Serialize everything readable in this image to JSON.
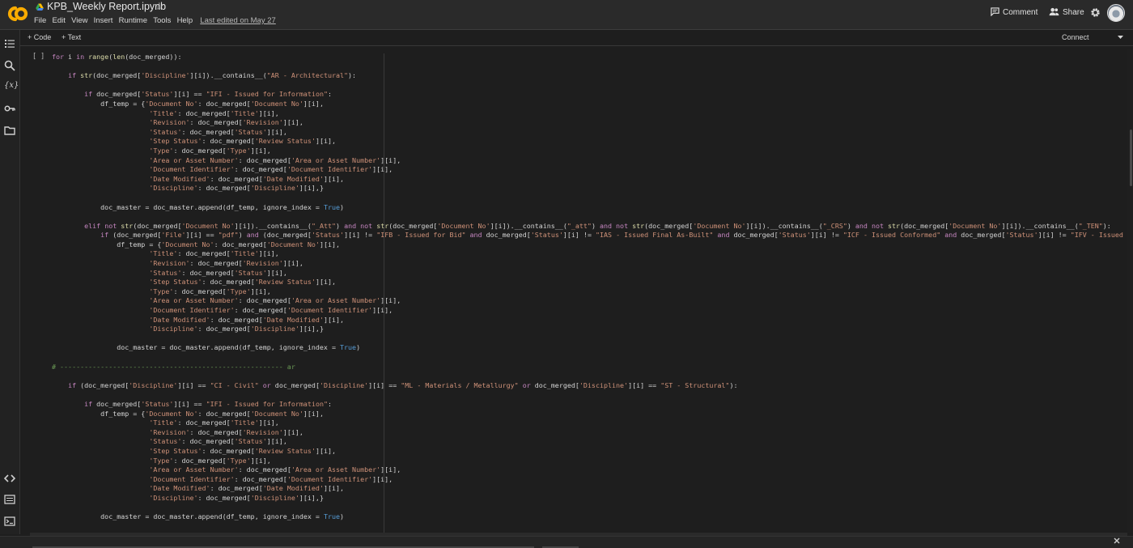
{
  "header": {
    "title": "KPB_Weekly Report.ipynb",
    "menu": [
      "File",
      "Edit",
      "View",
      "Insert",
      "Runtime",
      "Tools",
      "Help"
    ],
    "last_edited": "Last edited on May 27",
    "comment_label": "Comment",
    "share_label": "Share"
  },
  "colors": {
    "logo_orange": "#f9ab00",
    "background": "#1e1e1e",
    "header": "#2a2a2a",
    "keyword": "#c586c0",
    "string": "#ce9178",
    "comment": "#6a9955",
    "constant": "#569cd6"
  },
  "icons": {
    "logo": "colab-logo",
    "title_prefix": "drive-icon",
    "favorite": "star-icon",
    "sidebar": [
      "table-of-contents-icon",
      "search-icon",
      "variables-icon",
      "secrets-key-icon",
      "folder-icon",
      "code-snippets-icon",
      "command-palette-icon",
      "terminal-icon"
    ]
  },
  "toolbar": {
    "add_code": "+ Code",
    "add_text": "+ Text",
    "connect": "Connect"
  },
  "cell": {
    "run_indicator": "[ ]",
    "lines": [
      "for i in range(len(doc_merged)):",
      "",
      "    if str(doc_merged['Discipline'][i]).__contains__(\"AR - Architectural\"):",
      "",
      "        if doc_merged['Status'][i] == \"IFI - Issued for Information\":",
      "            df_temp = {'Document No': doc_merged['Document No'][i],",
      "                        'Title': doc_merged['Title'][i],",
      "                        'Revision': doc_merged['Revision'][i],",
      "                        'Status': doc_merged['Status'][i],",
      "                        'Step Status': doc_merged['Review Status'][i],",
      "                        'Type': doc_merged['Type'][i],",
      "                        'Area or Asset Number': doc_merged['Area or Asset Number'][i],",
      "                        'Document Identifier': doc_merged['Document Identifier'][i],",
      "                        'Date Modified': doc_merged['Date Modified'][i],",
      "                        'Discipline': doc_merged['Discipline'][i],}",
      "",
      "            doc_master = doc_master.append(df_temp, ignore_index = True)",
      "",
      "        elif not str(doc_merged['Document No'][i]).__contains__(\"_Att\") and not str(doc_merged['Document No'][i]).__contains__(\"_att\") and not str(doc_merged['Document No'][i]).__contains__(\"_CRS\") and not str(doc_merged['Document No'][i]).__contains__(\"_TEN\"):",
      "            if (doc_merged['File'][i] == \"pdf\") and (doc_merged['Status'][i] != \"IFB - Issued for Bid\" and doc_merged['Status'][i] != \"IAS - Issued Final As-Built\" and doc_merged['Status'][i] != \"ICF - Issued Conformed\" and doc_merged['Status'][i] != \"IFV - Issued",
      "                df_temp = {'Document No': doc_merged['Document No'][i],",
      "                        'Title': doc_merged['Title'][i],",
      "                        'Revision': doc_merged['Revision'][i],",
      "                        'Status': doc_merged['Status'][i],",
      "                        'Step Status': doc_merged['Review Status'][i],",
      "                        'Type': doc_merged['Type'][i],",
      "                        'Area or Asset Number': doc_merged['Area or Asset Number'][i],",
      "                        'Document Identifier': doc_merged['Document Identifier'][i],",
      "                        'Date Modified': doc_merged['Date Modified'][i],",
      "                        'Discipline': doc_merged['Discipline'][i],}",
      "",
      "                doc_master = doc_master.append(df_temp, ignore_index = True)",
      "",
      "# ------------------------------------------------------- ar",
      "",
      "    if (doc_merged['Discipline'][i] == \"CI - Civil\" or doc_merged['Discipline'][i] == \"ML - Materials / Metallurgy\" or doc_merged['Discipline'][i] == \"ST - Structural\"):",
      "",
      "        if doc_merged['Status'][i] == \"IFI - Issued for Information\":",
      "            df_temp = {'Document No': doc_merged['Document No'][i],",
      "                        'Title': doc_merged['Title'][i],",
      "                        'Revision': doc_merged['Revision'][i],",
      "                        'Status': doc_merged['Status'][i],",
      "                        'Step Status': doc_merged['Review Status'][i],",
      "                        'Type': doc_merged['Type'][i],",
      "                        'Area or Asset Number': doc_merged['Area or Asset Number'][i],",
      "                        'Document Identifier': doc_merged['Document Identifier'][i],",
      "                        'Date Modified': doc_merged['Date Modified'][i],",
      "                        'Discipline': doc_merged['Discipline'][i],}",
      "",
      "            doc_master = doc_master.append(df_temp, ignore_index = True)"
    ]
  }
}
